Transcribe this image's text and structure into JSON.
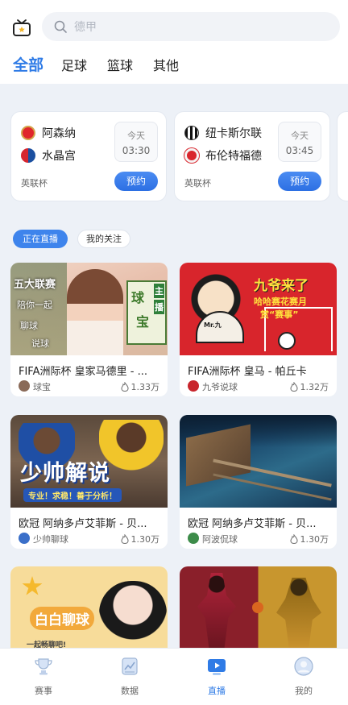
{
  "header": {
    "search_placeholder": "德甲",
    "tabs": [
      {
        "label": "全部",
        "active": true
      },
      {
        "label": "足球"
      },
      {
        "label": "篮球"
      },
      {
        "label": "其他"
      }
    ]
  },
  "matches": [
    {
      "home": "阿森纳",
      "away": "水晶宫",
      "day": "今天",
      "time": "03:30",
      "league": "英联杯",
      "action": "预约"
    },
    {
      "home": "纽卡斯尔联",
      "away": "布伦特福德",
      "day": "今天",
      "time": "03:45",
      "league": "英联杯",
      "action": "预约"
    }
  ],
  "filters": {
    "live": "正在直播",
    "following": "我的关注"
  },
  "streams": [
    {
      "title": "FIFA洲际杯   皇家马德里 - ...",
      "streamer": "球宝",
      "viewers": "1.33万",
      "thumb_text": [
        "五大联赛",
        "陪你一起",
        "聊球",
        "说球",
        "球",
        "宝",
        "主",
        "播"
      ]
    },
    {
      "title": "FIFA洲际杯  皇马 - 帕丘卡",
      "streamer": "九爷说球",
      "viewers": "1.32万",
      "thumb_text": [
        "九爷来了",
        "哈哈赛花赛月",
        "赏“赛事”",
        "Mr.九"
      ]
    },
    {
      "title": "欧冠   阿纳多卢艾菲斯 - 贝...",
      "streamer": "少帅聊球",
      "viewers": "1.30万",
      "thumb_text": [
        "少帅解说",
        "专业！求稳！善于分析！"
      ]
    },
    {
      "title": "欧冠   阿纳多卢艾菲斯 - 贝...",
      "streamer": "阿波侃球",
      "viewers": "1.30万",
      "thumb_text": []
    },
    {
      "thumb_text": [
        "白白聊球",
        "一起畅聊吧!"
      ]
    },
    {
      "thumb_text": []
    }
  ],
  "bottom_nav": [
    {
      "label": "赛事",
      "icon": "trophy-icon"
    },
    {
      "label": "数据",
      "icon": "chart-icon"
    },
    {
      "label": "直播",
      "icon": "live-tv-icon",
      "active": true
    },
    {
      "label": "我的",
      "icon": "profile-icon"
    }
  ],
  "colors": {
    "accent": "#2f7be6",
    "background": "#edf1f7"
  }
}
